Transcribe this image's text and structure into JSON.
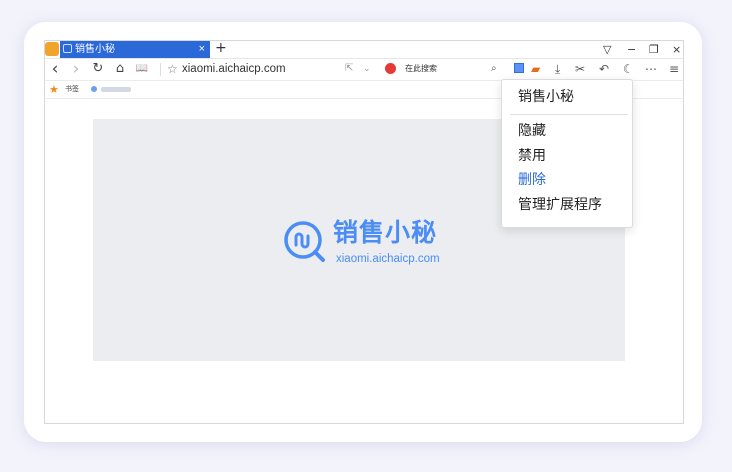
{
  "browser": {
    "tab": {
      "title": "销售小秘",
      "close": "×"
    },
    "new_tab": "+",
    "window_controls": [
      "▽",
      "−",
      "❐",
      "×"
    ],
    "nav": {
      "back": "‹",
      "forward": "›",
      "reload": "↻",
      "home": "⌂",
      "reader": "📖",
      "url": "xiaomi.aichaicp.com",
      "search_placeholder": "在此搜索",
      "menu": "⋯"
    },
    "bookmarks": {
      "label": "书签"
    }
  },
  "page": {
    "logo": {
      "name": "销售小秘",
      "url": "xiaomi.aichaicp.com"
    }
  },
  "context_menu": {
    "title": "销售小秘",
    "items": [
      {
        "label": "隐藏",
        "active": false
      },
      {
        "label": "禁用",
        "active": false
      },
      {
        "label": "删除",
        "active": true
      },
      {
        "label": "管理扩展程序",
        "active": false
      }
    ]
  },
  "colors": {
    "accent": "#2b68d8",
    "logo": "#4b8df5",
    "card_bg": "#f2f3fb"
  }
}
